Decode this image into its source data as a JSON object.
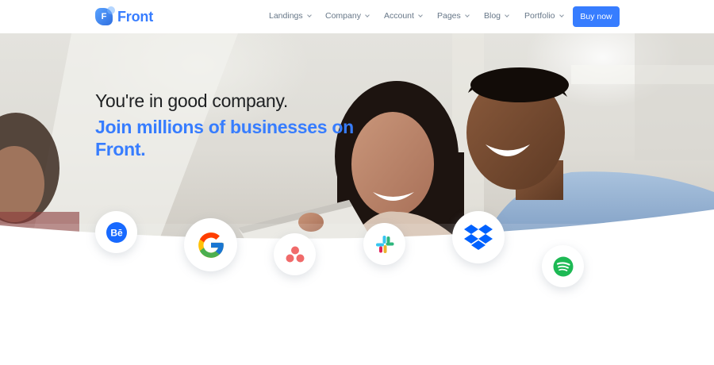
{
  "header": {
    "brand": "Front",
    "brand_initial": "F",
    "nav": [
      {
        "label": "Landings"
      },
      {
        "label": "Company"
      },
      {
        "label": "Account"
      },
      {
        "label": "Pages"
      },
      {
        "label": "Blog"
      },
      {
        "label": "Portfolio"
      }
    ],
    "cta_label": "Buy now"
  },
  "hero": {
    "title": "You're in good company.",
    "subtitle": "Join millions of businesses on Front."
  },
  "clients": [
    {
      "name": "Behance",
      "icon": "behance-icon",
      "glyph": "Bē"
    },
    {
      "name": "Google",
      "icon": "google-icon"
    },
    {
      "name": "Asana",
      "icon": "asana-icon"
    },
    {
      "name": "Slack",
      "icon": "slack-icon"
    },
    {
      "name": "Dropbox",
      "icon": "dropbox-icon"
    },
    {
      "name": "Spotify",
      "icon": "spotify-icon"
    }
  ],
  "colors": {
    "primary": "#377dff",
    "heading": "#1e2022",
    "nav_text": "#677788",
    "behance": "#1769ff",
    "spotify": "#1db954",
    "dropbox": "#0061fe"
  }
}
